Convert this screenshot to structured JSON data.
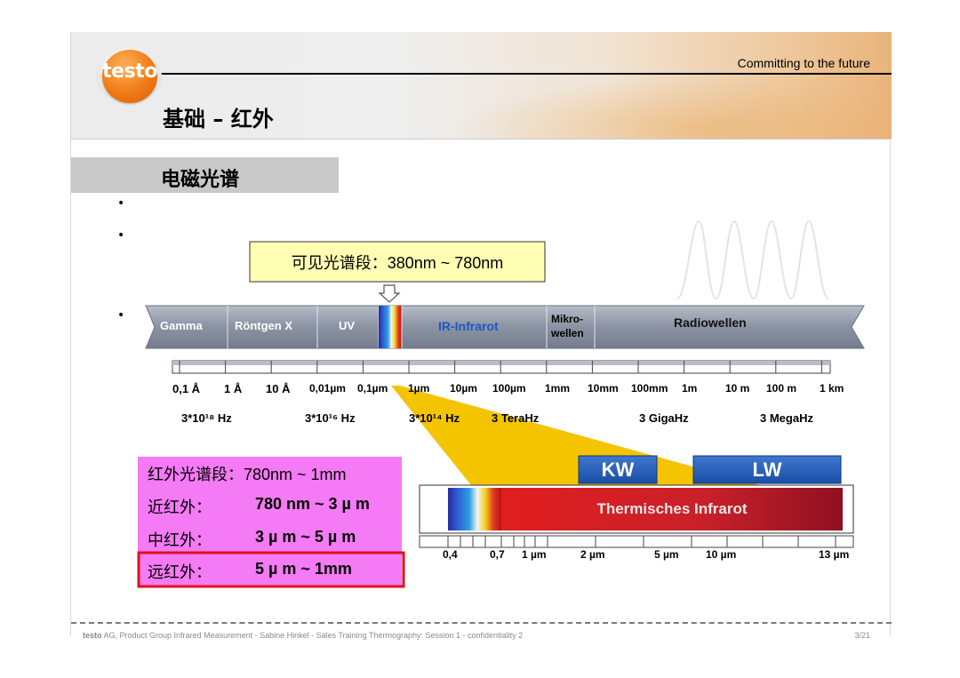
{
  "header": {
    "logo_text": "testo",
    "tagline": "Committing to the future",
    "title": "基础 – 红外"
  },
  "section": {
    "title": "电磁光谱"
  },
  "bullets": [
    "•",
    "•",
    "•"
  ],
  "figure": {
    "visible_callout": "可见光谱段：380nm ~ 780nm",
    "bands": [
      "Gamma",
      "Röntgen X",
      "UV",
      "IR-Infrarot",
      "Mikro-",
      "wellen",
      "Radiowellen"
    ],
    "wavelength_ticks": [
      "0,1 Å",
      "1 Å",
      "10 Å",
      "0,01µm",
      "0,1µm",
      "1µm",
      "10µm",
      "100µm",
      "1mm",
      "10mm",
      "100mm",
      "1m",
      "10 m",
      "100 m",
      "1 km"
    ],
    "frequency_labels": [
      "3*10¹⁸ Hz",
      "3*10¹⁶ Hz",
      "3*10¹⁴ Hz",
      "3 TeraHz",
      "3 GigaHz",
      "3 MegaHz"
    ],
    "ir_ranges": {
      "header": "红外光谱段：780nm ~ 1mm",
      "rows": [
        {
          "label": "近红外：",
          "value": "780 nm ~ 3 µ m"
        },
        {
          "label": "中红外：",
          "value": "3 µ m ~ 5 µ m"
        },
        {
          "label": "远红外：",
          "value": "5 µ m ~ 1mm"
        }
      ]
    },
    "kw_label": "KW",
    "lw_label": "LW",
    "thermal_label": "Thermisches Infrarot",
    "thermal_ticks": [
      "0,4",
      "0,7",
      "1 µm",
      "2 µm",
      "5 µm",
      "10 µm",
      "13 µm"
    ]
  },
  "footer": {
    "brand": "testo",
    "text": " AG, Product Group Infrared Measurement - Sabine Hinkel - Sales Training Thermography: Session 1 - confidentiality 2",
    "page": "3/21"
  },
  "colors": {
    "brand_orange": "#f07a16",
    "callout_fill": "#ffffb4",
    "band_gray": "#8e96a6",
    "ir_table_fill": "#f57af5",
    "highlight_red": "#e0101e",
    "kw_lw_blue": "#1f5bb8",
    "thermal_red": "#d42a2a",
    "funnel_yellow": "#f5c400"
  }
}
